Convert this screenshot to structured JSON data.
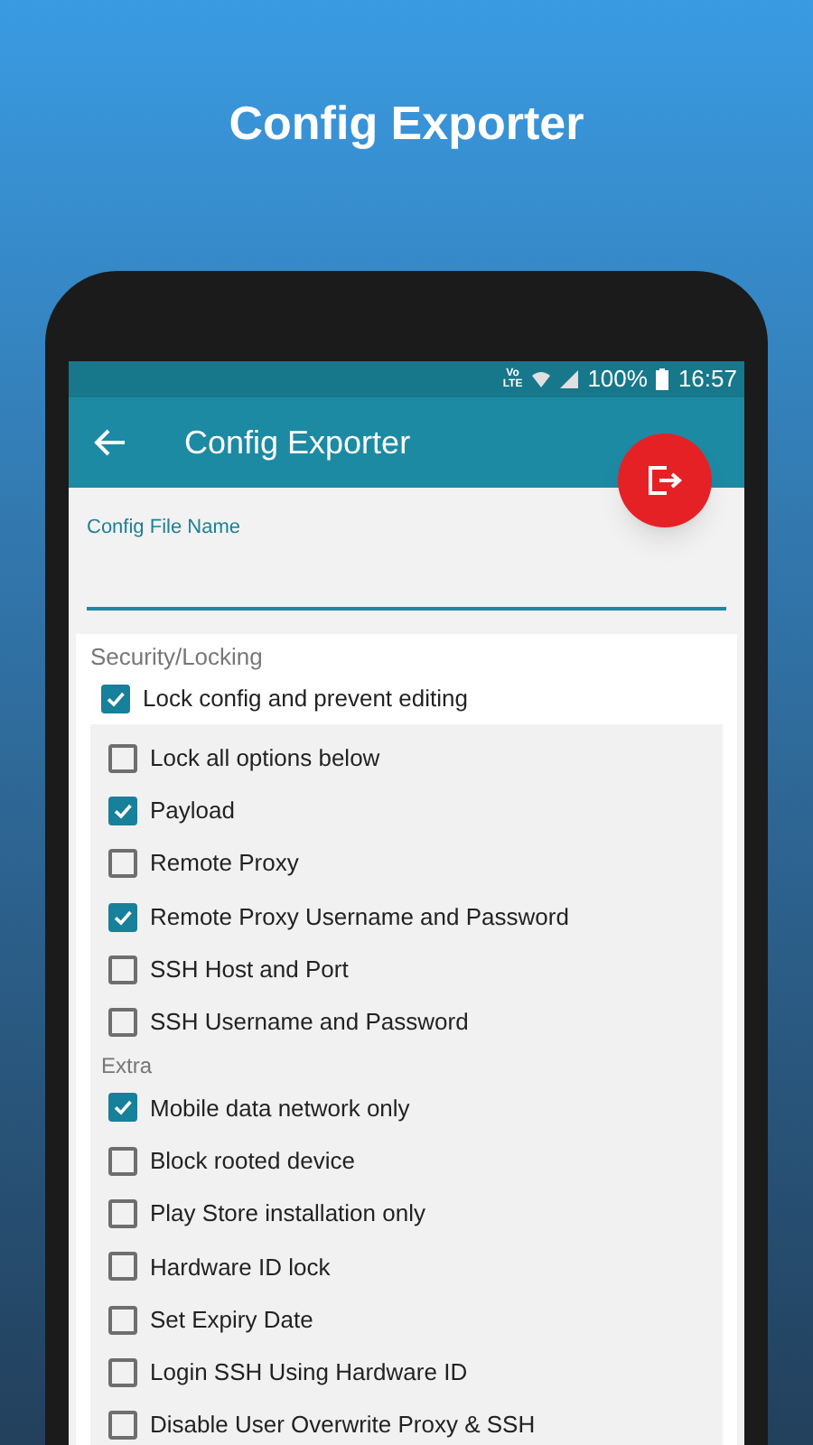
{
  "headline": "Config Exporter",
  "status_bar": {
    "network": [
      "Vo",
      "LTE"
    ],
    "battery": "100%",
    "time": "16:57"
  },
  "app_bar": {
    "title": "Config Exporter"
  },
  "file_name_field": {
    "label": "Config File Name"
  },
  "security": {
    "title": "Security/Locking",
    "lock": {
      "label": "Lock config and prevent editing",
      "checked": true
    },
    "panel": [
      {
        "kind": "option",
        "label": "Lock all options below",
        "checked": false
      },
      {
        "kind": "option",
        "label": "Payload",
        "checked": true
      },
      {
        "kind": "option",
        "label": "Remote Proxy",
        "checked": false
      },
      {
        "kind": "option",
        "label": "Remote Proxy Username and Password",
        "checked": true
      },
      {
        "kind": "option",
        "label": "SSH Host and Port",
        "checked": false
      },
      {
        "kind": "option",
        "label": "SSH Username and Password",
        "checked": false
      },
      {
        "kind": "heading",
        "label": "Extra"
      },
      {
        "kind": "option",
        "label": "Mobile data network only",
        "checked": true
      },
      {
        "kind": "option",
        "label": "Block rooted device",
        "checked": false
      },
      {
        "kind": "option",
        "label": "Play Store installation only",
        "checked": false
      },
      {
        "kind": "option",
        "label": "Hardware ID lock",
        "checked": false
      },
      {
        "kind": "option",
        "label": "Set Expiry Date",
        "checked": false
      },
      {
        "kind": "option",
        "label": "Login SSH Using Hardware ID",
        "checked": false
      },
      {
        "kind": "option",
        "label": "Disable User Overwrite Proxy & SSH",
        "checked": false
      }
    ]
  }
}
